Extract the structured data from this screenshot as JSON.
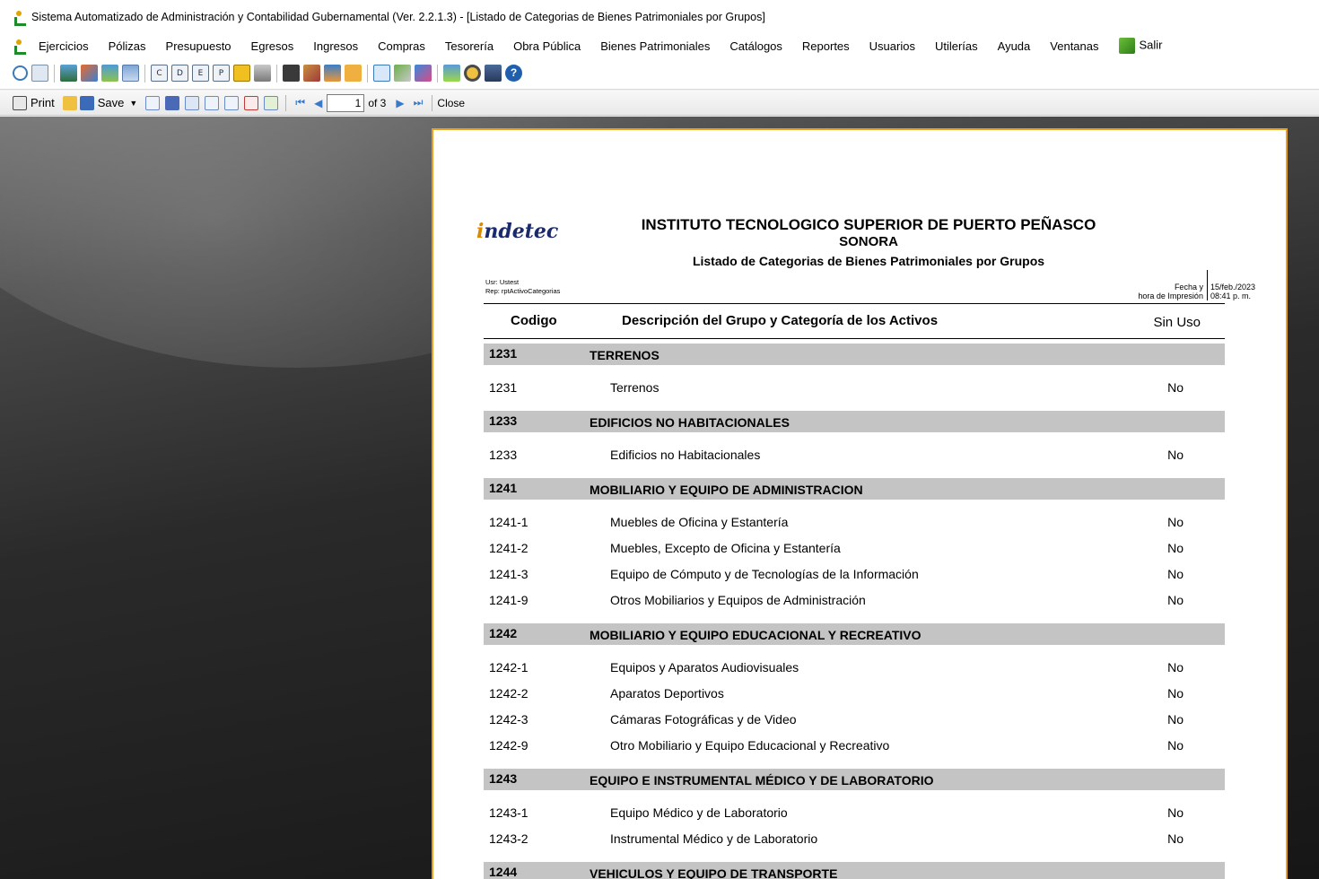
{
  "window": {
    "title": "Sistema Automatizado de Administración y Contabilidad Gubernamental (Ver. 2.2.1.3) - [Listado de Categorias de Bienes Patrimoniales por Grupos]"
  },
  "menu": {
    "items": [
      "Ejercicios",
      "Pólizas",
      "Presupuesto",
      "Egresos",
      "Ingresos",
      "Compras",
      "Tesorería",
      "Obra Pública",
      "Bienes Patrimoniales",
      "Catálogos",
      "Reportes",
      "Usuarios",
      "Utilerías",
      "Ayuda",
      "Ventanas"
    ],
    "exit_label": "Salir"
  },
  "toolbar": {
    "letter_buttons": [
      "C",
      "D",
      "E",
      "P"
    ]
  },
  "report_toolbar": {
    "print_label": "Print",
    "save_label": "Save",
    "page_value": "1",
    "page_of": "of 3",
    "close_label": "Close"
  },
  "report": {
    "logo_text": "indetec",
    "org_name": "INSTITUTO TECNOLOGICO SUPERIOR DE PUERTO PEÑASCO",
    "state": "SONORA",
    "title": "Listado de Categorias de Bienes Patrimoniales por Grupos",
    "user": "Usr: Ustest",
    "rep": "Rep: rptActivoCategorias",
    "date_label_1": "Fecha y",
    "date_label_2": "hora de Impresión",
    "date_value": "15/feb./2023",
    "time_value": "08:41 p. m.",
    "columns": {
      "code": "Codigo",
      "description": "Descripción del Grupo y Categoría de los Activos",
      "sin_uso": "Sin Uso"
    },
    "groups": [
      {
        "code": "1231",
        "name": "TERRENOS",
        "items": [
          {
            "code": "1231",
            "desc": "Terrenos",
            "sin_uso": "No"
          }
        ]
      },
      {
        "code": "1233",
        "name": "EDIFICIOS NO HABITACIONALES",
        "items": [
          {
            "code": "1233",
            "desc": "Edificios no Habitacionales",
            "sin_uso": "No"
          }
        ]
      },
      {
        "code": "1241",
        "name": "MOBILIARIO Y EQUIPO DE ADMINISTRACION",
        "items": [
          {
            "code": "1241-1",
            "desc": "Muebles de Oficina y Estantería",
            "sin_uso": "No"
          },
          {
            "code": "1241-2",
            "desc": "Muebles, Excepto de Oficina y Estantería",
            "sin_uso": "No"
          },
          {
            "code": "1241-3",
            "desc": "Equipo de Cómputo y de Tecnologías de la Información",
            "sin_uso": "No"
          },
          {
            "code": "1241-9",
            "desc": "Otros Mobiliarios y Equipos de Administración",
            "sin_uso": "No"
          }
        ]
      },
      {
        "code": "1242",
        "name": "MOBILIARIO Y EQUIPO EDUCACIONAL Y RECREATIVO",
        "items": [
          {
            "code": "1242-1",
            "desc": "Equipos y Aparatos Audiovisuales",
            "sin_uso": "No"
          },
          {
            "code": "1242-2",
            "desc": "Aparatos Deportivos",
            "sin_uso": "No"
          },
          {
            "code": "1242-3",
            "desc": "Cámaras Fotográficas y de Video",
            "sin_uso": "No"
          },
          {
            "code": "1242-9",
            "desc": "Otro Mobiliario y Equipo Educacional y Recreativo",
            "sin_uso": "No"
          }
        ]
      },
      {
        "code": "1243",
        "name": "EQUIPO E INSTRUMENTAL MÉDICO Y DE LABORATORIO",
        "items": [
          {
            "code": "1243-1",
            "desc": "Equipo Médico y de Laboratorio",
            "sin_uso": "No"
          },
          {
            "code": "1243-2",
            "desc": "Instrumental Médico y de Laboratorio",
            "sin_uso": "No"
          }
        ]
      },
      {
        "code": "1244",
        "name": "VEHICULOS Y EQUIPO DE TRANSPORTE",
        "items": []
      }
    ]
  }
}
